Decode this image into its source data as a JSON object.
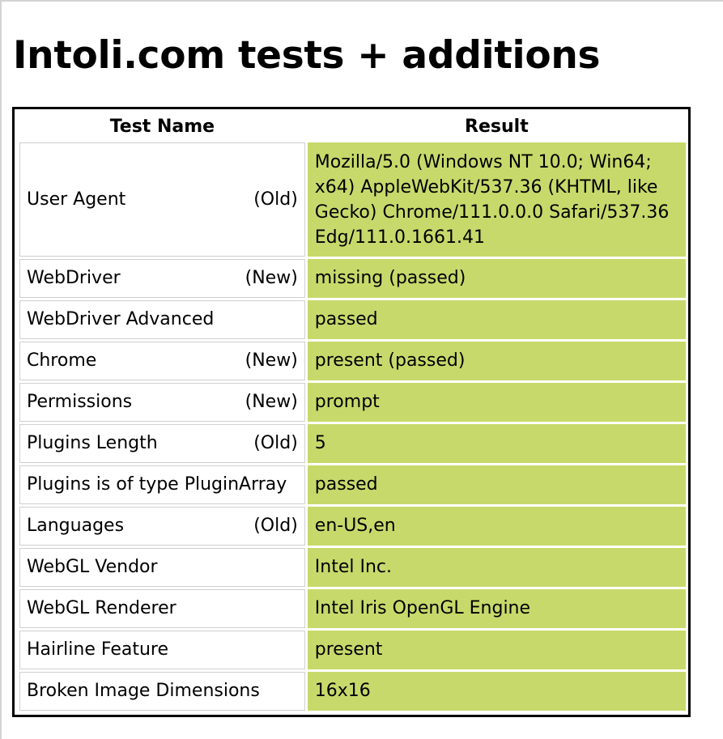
{
  "page": {
    "title": "Intoli.com tests + additions"
  },
  "table": {
    "headers": {
      "name": "Test Name",
      "result": "Result"
    },
    "rows": [
      {
        "name": "User Agent",
        "tag": "(Old)",
        "result": "Mozilla/5.0 (Windows NT 10.0; Win64; x64) AppleWebKit/537.36 (KHTML, like Gecko) Chrome/111.0.0.0 Safari/537.36 Edg/111.0.1661.41"
      },
      {
        "name": "WebDriver",
        "tag": "(New)",
        "result": "missing (passed)"
      },
      {
        "name": "WebDriver Advanced",
        "tag": "",
        "result": "passed"
      },
      {
        "name": "Chrome",
        "tag": "(New)",
        "result": "present (passed)"
      },
      {
        "name": "Permissions",
        "tag": "(New)",
        "result": "prompt"
      },
      {
        "name": "Plugins Length",
        "tag": "(Old)",
        "result": "5"
      },
      {
        "name": "Plugins is of type PluginArray",
        "tag": "",
        "result": "passed"
      },
      {
        "name": "Languages",
        "tag": "(Old)",
        "result": "en-US,en"
      },
      {
        "name": "WebGL Vendor",
        "tag": "",
        "result": "Intel Inc."
      },
      {
        "name": "WebGL Renderer",
        "tag": "",
        "result": "Intel Iris OpenGL Engine"
      },
      {
        "name": "Hairline Feature",
        "tag": "",
        "result": "present"
      },
      {
        "name": "Broken Image Dimensions",
        "tag": "",
        "result": "16x16"
      }
    ]
  },
  "colors": {
    "passed_cell": "#c8d96b",
    "table_border": "#000000"
  }
}
